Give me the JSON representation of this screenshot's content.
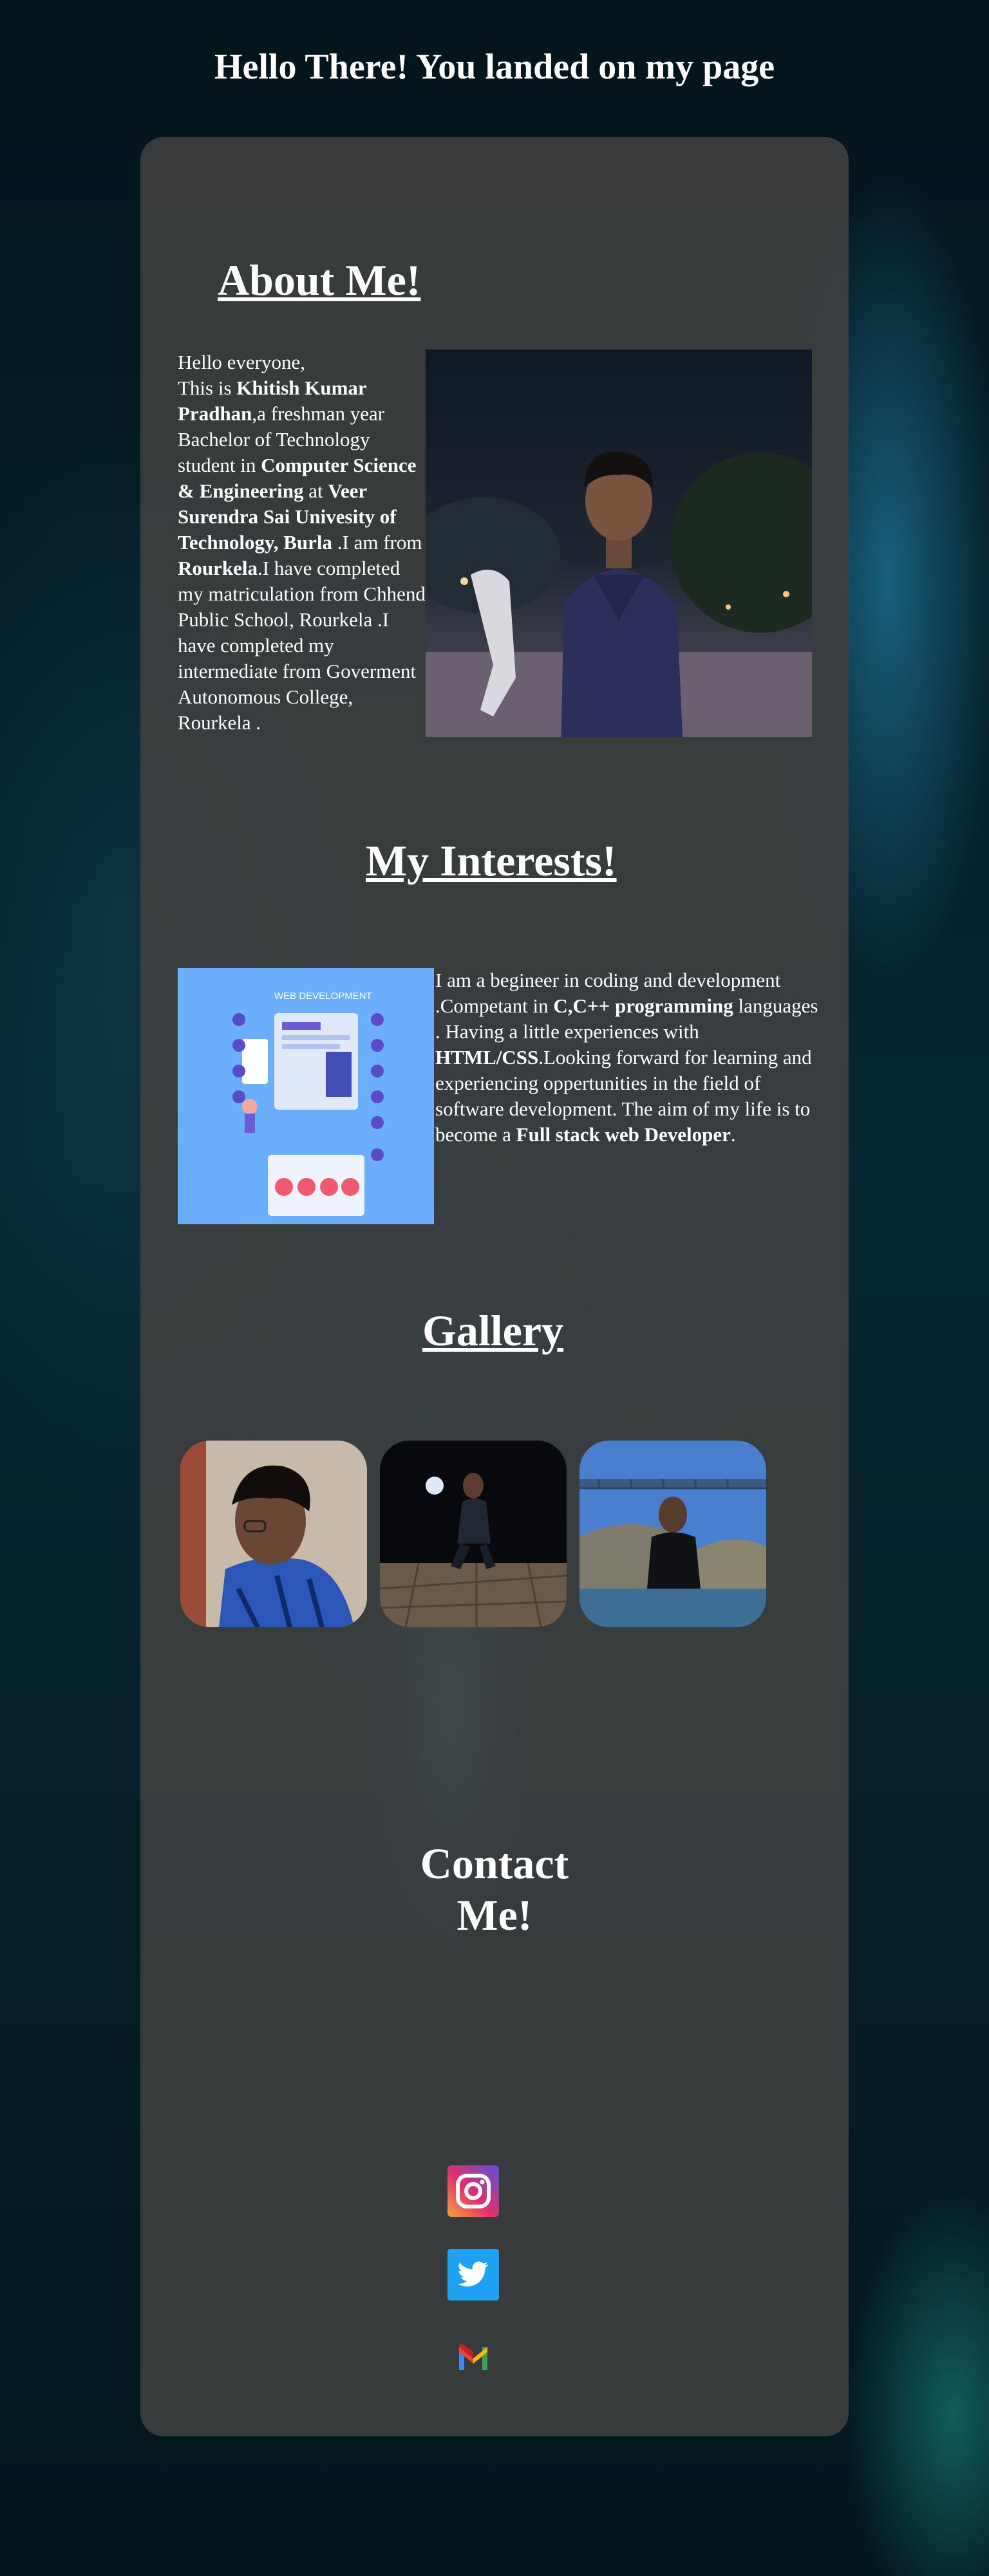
{
  "header": {
    "title": "Hello There! You landed on my page"
  },
  "about": {
    "title": "About Me!",
    "p_greeting": "Hello everyone,",
    "p_this_is": "This is ",
    "p_name": "Khitish Kumar Pradhan",
    "p_after_name": ",a freshman year Bachelor of Technology student in ",
    "p_branch": "Computer Science & Engineering",
    "p_at": " at ",
    "p_university": "Veer Surendra Sai Univesity of Technology, Burla",
    "p_from": " .I am from ",
    "p_city": "Rourkela",
    "p_rest": ".I have completed my matriculation from Chhend Public School, Rourkela .I have completed my intermediate from Goverment Autonomous College, Rourkela ."
  },
  "interests": {
    "title": "My Interests!",
    "image_heading": "WEB DEVELOPMENT",
    "p_start": "I am a begineer in coding and development .Competant in ",
    "p_langs": "C,C++ programming",
    "p_mid": " languages . Having a little experiences with ",
    "p_web": "HTML/CSS",
    "p_end1": ".Looking forward for learning and experiencing oppertunities in the field of software development. The aim of my life is to become a ",
    "p_goal": "Full stack web Developer",
    "p_end2": "."
  },
  "gallery": {
    "title": "Gallery"
  },
  "contact": {
    "title_line1": "Contact",
    "title_line2": "Me!",
    "icons": [
      "instagram-icon",
      "twitter-icon",
      "gmail-icon"
    ]
  },
  "colors": {
    "card": "#404040",
    "instagram": "#c13584",
    "twitter": "#1da1f2",
    "interest_bg": "#6aaefc"
  }
}
